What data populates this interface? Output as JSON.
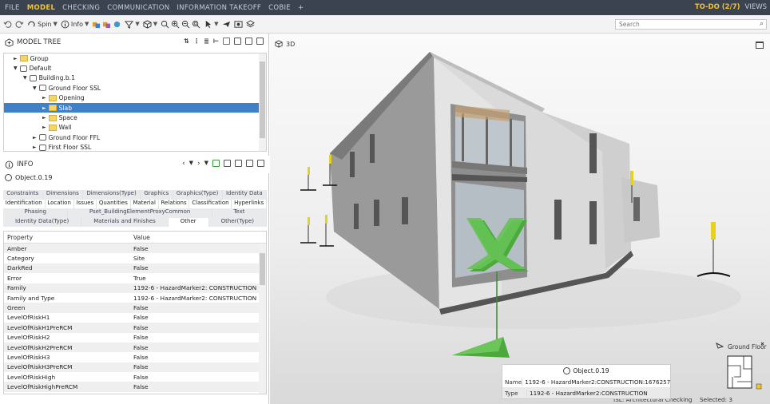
{
  "menubar": {
    "items": [
      "FILE",
      "MODEL",
      "CHECKING",
      "COMMUNICATION",
      "INFORMATION TAKEOFF",
      "COBIE",
      "+"
    ],
    "active": "MODEL",
    "todo": "TO-DO (2/7)",
    "views": "VIEWS"
  },
  "toolbar": {
    "spin_label": "Spin",
    "info_label": "Info",
    "search_placeholder": "Search"
  },
  "model_tree": {
    "title": "MODEL TREE",
    "rows": [
      {
        "label": "Group",
        "indent": 1,
        "arrow": "►",
        "folder": true,
        "selected": false
      },
      {
        "label": "Default",
        "indent": 1,
        "arrow": "▼",
        "folder": false,
        "selected": false
      },
      {
        "label": "Building.b.1",
        "indent": 2,
        "arrow": "▼",
        "folder": false,
        "selected": false
      },
      {
        "label": "Ground Floor SSL",
        "indent": 3,
        "arrow": "▼",
        "folder": false,
        "selected": false
      },
      {
        "label": "Opening",
        "indent": 4,
        "arrow": "►",
        "folder": true,
        "selected": false
      },
      {
        "label": "Slab",
        "indent": 4,
        "arrow": "►",
        "folder": true,
        "selected": true
      },
      {
        "label": "Space",
        "indent": 4,
        "arrow": "►",
        "folder": true,
        "selected": false
      },
      {
        "label": "Wall",
        "indent": 4,
        "arrow": "►",
        "folder": true,
        "selected": false
      },
      {
        "label": "Ground Floor FFL",
        "indent": 3,
        "arrow": "►",
        "folder": false,
        "selected": false
      },
      {
        "label": "First Floor SSL",
        "indent": 3,
        "arrow": "►",
        "folder": false,
        "selected": false
      }
    ]
  },
  "info": {
    "title": "INFO",
    "object": "Object.0.19",
    "tab_rows": [
      [
        "Constraints",
        "Dimensions",
        "Dimensions(Type)",
        "Graphics",
        "Graphics(Type)",
        "Identity Data"
      ],
      [
        "Identification",
        "Location",
        "Issues",
        "Quantities",
        "Material",
        "Relations",
        "Classification",
        "Hyperlinks"
      ],
      [
        "Phasing",
        "Pset_BuildingElementProxyCommon",
        "Text"
      ],
      [
        "Identity Data(Type)",
        "Materials and Finishes",
        "Other",
        "Other(Type)"
      ]
    ],
    "active_tab": "Other",
    "columns": [
      "Property",
      "Value"
    ],
    "properties": [
      [
        "Amber",
        "False"
      ],
      [
        "Category",
        "Site"
      ],
      [
        "DarkRed",
        "False"
      ],
      [
        "Error",
        "True"
      ],
      [
        "Family",
        "1192-6 - HazardMarker2: CONSTRUCTION"
      ],
      [
        "Family and Type",
        "1192-6 - HazardMarker2: CONSTRUCTION"
      ],
      [
        "Green",
        "False"
      ],
      [
        "LevelOfRiskH1",
        "False"
      ],
      [
        "LevelOfRiskH1PreRCM",
        "False"
      ],
      [
        "LevelOfRiskH2",
        "False"
      ],
      [
        "LevelOfRiskH2PreRCM",
        "False"
      ],
      [
        "LevelOfRiskH3",
        "False"
      ],
      [
        "LevelOfRiskH3PreRCM",
        "False"
      ],
      [
        "LevelOfRiskHigh",
        "False"
      ],
      [
        "LevelOfRiskHighPreRCM",
        "False"
      ]
    ]
  },
  "viewport": {
    "label": "3D",
    "tooltip": {
      "title": "Object.0.19",
      "rows": [
        [
          "Name",
          "1192-6 - HazardMarker2:CONSTRUCTION:1676257"
        ],
        [
          "Type",
          "1192-6 - HazardMarker2:CONSTRUCTION"
        ]
      ]
    },
    "minimap_label": "Ground Floor",
    "status": "ISL: Architectural Checking",
    "selected": "Selected: 3"
  },
  "colors": {
    "menubar_bg": "#3b4250",
    "accent": "#f2c230",
    "selection": "#3f80c8",
    "marker_green": "#4caa3c"
  }
}
